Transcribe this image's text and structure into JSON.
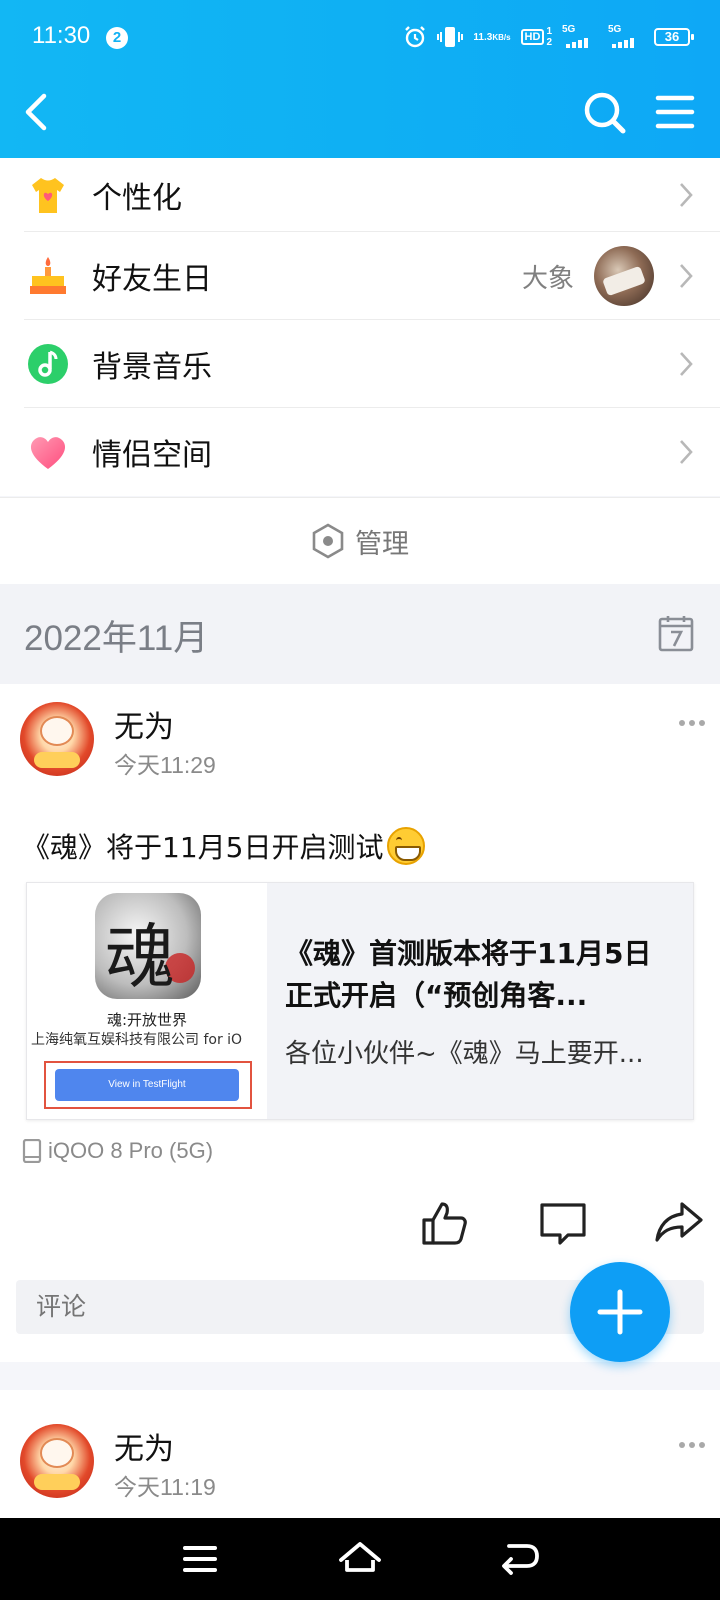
{
  "status_bar": {
    "time": "11:30",
    "notification_count": "2",
    "net_speed_value": "11.3",
    "net_speed_unit": "KB/s",
    "hd_label": "HD",
    "sim1_label": "1",
    "sim2_label": "2",
    "network1": "5G",
    "network2": "5G",
    "battery": "36"
  },
  "list": {
    "items": [
      {
        "label": "个性化",
        "icon": "tshirt-heart-icon"
      },
      {
        "label": "好友生日",
        "sub": "大象",
        "icon": "birthday-cake-icon"
      },
      {
        "label": "背景音乐",
        "icon": "music-note-icon"
      },
      {
        "label": "情侣空间",
        "icon": "heart-icon"
      }
    ],
    "manage_label": "管理"
  },
  "month": {
    "label": "2022年11月"
  },
  "post": {
    "author": "无为",
    "time": "今天11:29",
    "text": "《魂》将于11月5日开启测试",
    "link_card": {
      "thumb_title": "魂:开放世界",
      "thumb_company": "上海纯氧互娱科技有限公司 for iO",
      "thumb_button": "View in TestFlight",
      "app_glyph": "魂",
      "title": "《魂》首测版本将于11月5日正式开启（“预创角客...",
      "desc": "各位小伙伴~《魂》马上要开..."
    },
    "device": "iQOO 8 Pro (5G)",
    "comment_placeholder": "评论"
  },
  "post2": {
    "author": "无为",
    "time": "今天11:19"
  },
  "colors": {
    "header_blue": "#12b7f4",
    "fab_blue": "#0e9ef5"
  }
}
